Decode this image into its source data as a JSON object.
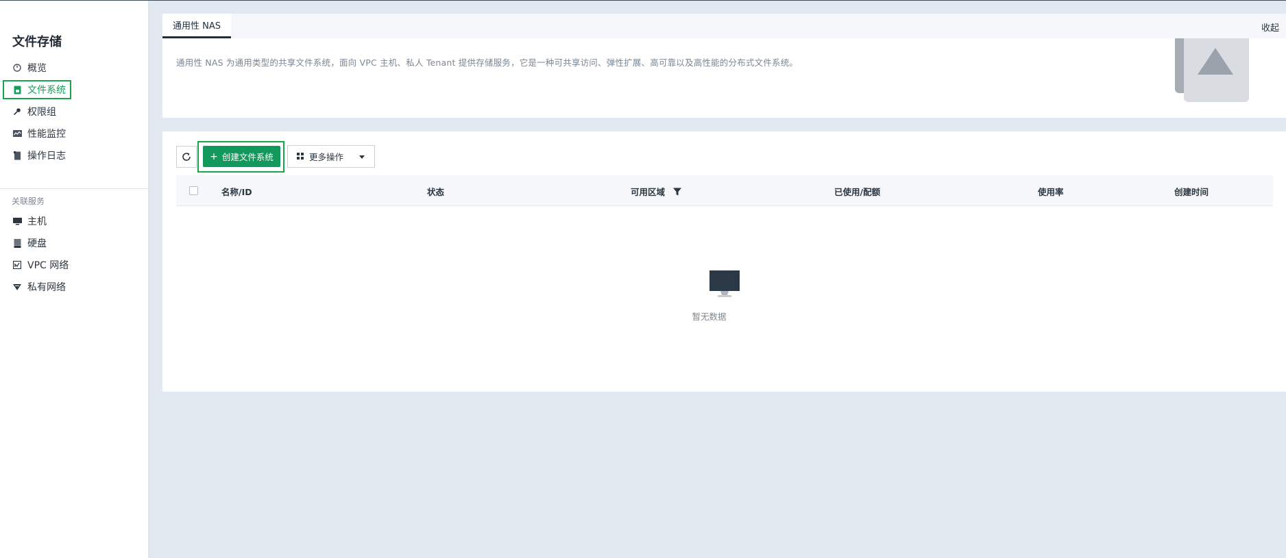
{
  "sidebar": {
    "title": "文件存储",
    "items": [
      {
        "label": "概览",
        "icon": "dashboard-icon"
      },
      {
        "label": "文件系统",
        "icon": "file-system-icon",
        "active": true
      },
      {
        "label": "权限组",
        "icon": "key-icon"
      },
      {
        "label": "性能监控",
        "icon": "monitor-chart-icon"
      },
      {
        "label": "操作日志",
        "icon": "log-icon"
      }
    ],
    "section_title": "关联服务",
    "related": [
      {
        "label": "主机",
        "icon": "host-icon"
      },
      {
        "label": "硬盘",
        "icon": "disk-icon"
      },
      {
        "label": "VPC 网络",
        "icon": "vpc-icon"
      },
      {
        "label": "私有网络",
        "icon": "private-network-icon"
      }
    ]
  },
  "tabs": [
    {
      "label": "通用性 NAS",
      "active": true
    }
  ],
  "collapse_label": "收起",
  "intro": {
    "text": "通用性 NAS 为通用类型的共享文件系统，面向 VPC 主机、私人 Tenant 提供存储服务，它是一种可共享访问、弹性扩展、高可靠以及高性能的分布式文件系统。"
  },
  "toolbar": {
    "create_label": "创建文件系统",
    "more_label": "更多操作"
  },
  "table": {
    "columns": [
      "名称/ID",
      "状态",
      "可用区域",
      "已使用/配额",
      "使用率",
      "创建时间"
    ],
    "rows": [],
    "empty_text": "暂无数据"
  },
  "colors": {
    "accent": "#12985a",
    "highlight": "#16a34a",
    "background": "#e1e8ef"
  }
}
